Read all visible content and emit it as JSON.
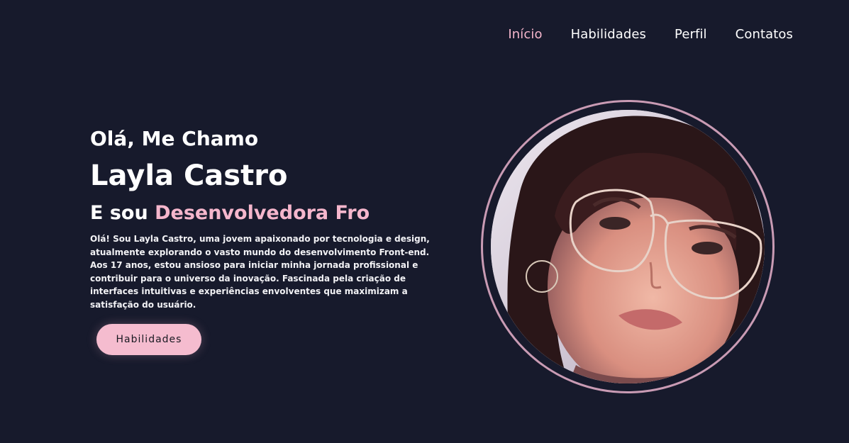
{
  "nav": {
    "items": [
      {
        "label": "Início",
        "active": true
      },
      {
        "label": "Habilidades",
        "active": false
      },
      {
        "label": "Perfil",
        "active": false
      },
      {
        "label": "Contatos",
        "active": false
      }
    ]
  },
  "hero": {
    "greeting": "Olá, Me Chamo",
    "name": "Layla Castro",
    "role_prefix": "E sou ",
    "role_typed": "Desenvolvedora Fro",
    "bio": "Olá! Sou Layla Castro, uma jovem apaixonado por tecnologia e design, atualmente explorando o vasto mundo do desenvolvimento Front-end. Aos 17 anos, estou ansioso para iniciar minha jornada profissional e contribuir para o universo da inovação. Fascinada pela criação de interfaces intuitivas e experiências envolventes que maximizam a satisfação do usuário.",
    "cta_label": "Habilidades"
  },
  "colors": {
    "background": "#171a2c",
    "accent": "#f5b6cc",
    "ring": "#c99bb4"
  }
}
